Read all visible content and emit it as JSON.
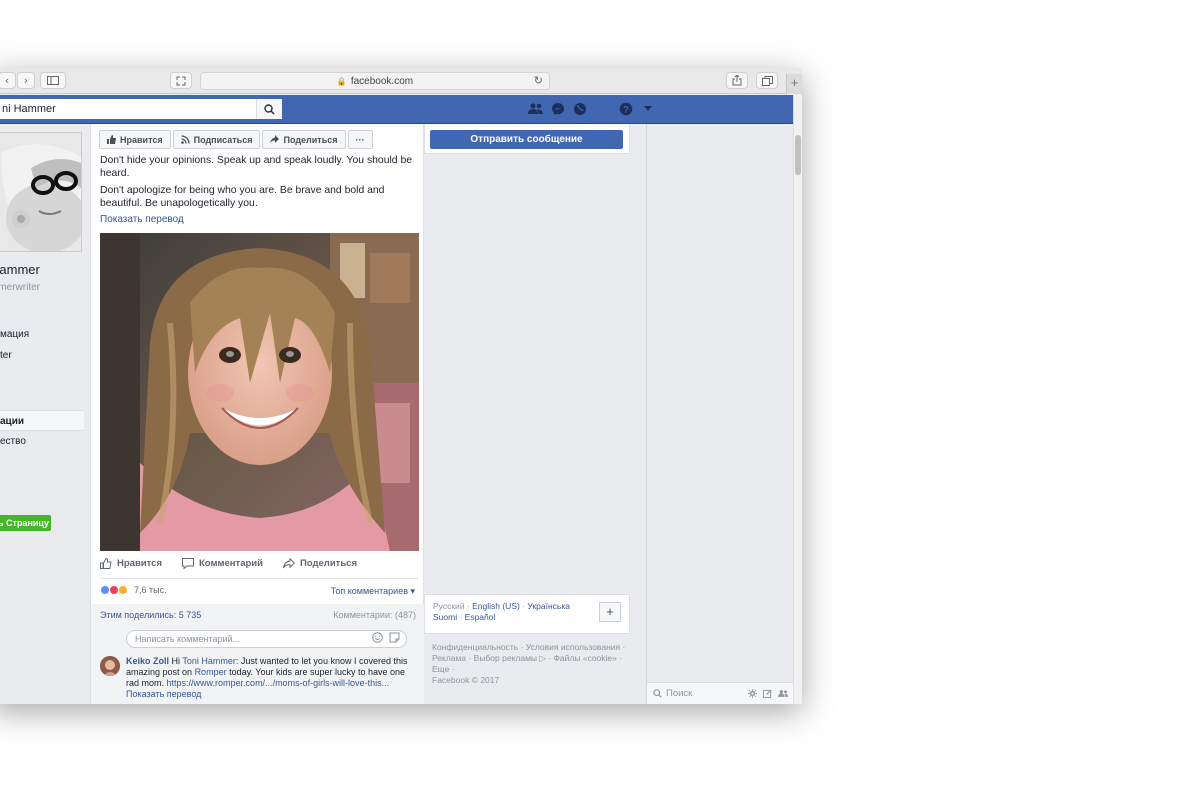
{
  "browser": {
    "url": "facebook.com"
  },
  "header": {
    "search_value": "ni Hammer"
  },
  "profile": {
    "name": "Hammer",
    "handle": "mmerwriter",
    "nav": [
      {
        "label": "",
        "active": false
      },
      {
        "label": "мация",
        "active": false
      },
      {
        "label": "ter",
        "active": false
      },
      {
        "label": "",
        "active": false
      },
      {
        "label": "",
        "active": false
      },
      {
        "label": "ации",
        "active": true
      },
      {
        "label": "ество",
        "active": false
      }
    ],
    "cta_label": "ь Страницу"
  },
  "page_actions": {
    "like": "Нравится",
    "follow": "Подписаться",
    "share": "Поделиться",
    "more": "···",
    "send_message": "Отправить сообщение"
  },
  "post": {
    "text_1": "Don't hide your opinions. Speak up and speak loudly. You should be heard.",
    "text_2": "Don't apologize for being who you are. Be brave and bold and beautiful. Be unapologetically you.",
    "translate": "Показать перевод",
    "actions": {
      "like": "Нравится",
      "comment": "Комментарий",
      "share": "Поделиться"
    },
    "reactions_count": "7,6 тыс.",
    "top_comments": "Топ комментариев ▾",
    "shares": "Этим поделились: 5 735",
    "comments_count": "Комментарии: (487)",
    "comment_placeholder": "Написать комментарий...",
    "comment": {
      "author": "Keiko Zoll",
      "mention": "Toni Hammer",
      "text_a": "Hi",
      "text_b": ": Just wanted to let you know I covered this amazing post on",
      "romper": "Romper",
      "text_c": "today. Your kids are super lucky to have one rad mom.",
      "link": "https://www.romper.com/.../moms-of-girls-will-love-this...",
      "translate": "Показать перевод"
    }
  },
  "languages": {
    "current": "Русский",
    "sep": " · ",
    "list": [
      "English (US)",
      "Українська",
      "Suomi",
      "Español"
    ]
  },
  "footer": {
    "line1": "Конфиденциальность · Условия использования ·",
    "line2": "Реклама · Выбор рекламы ▷ · Файлы «cookie» ·",
    "line3": "Еще ·",
    "line4": "Facebook © 2017"
  },
  "chat": {
    "search_placeholder": "Поиск"
  },
  "colors": {
    "fb_blue": "#4267b2",
    "link": "#365899",
    "green": "#42b72a"
  }
}
